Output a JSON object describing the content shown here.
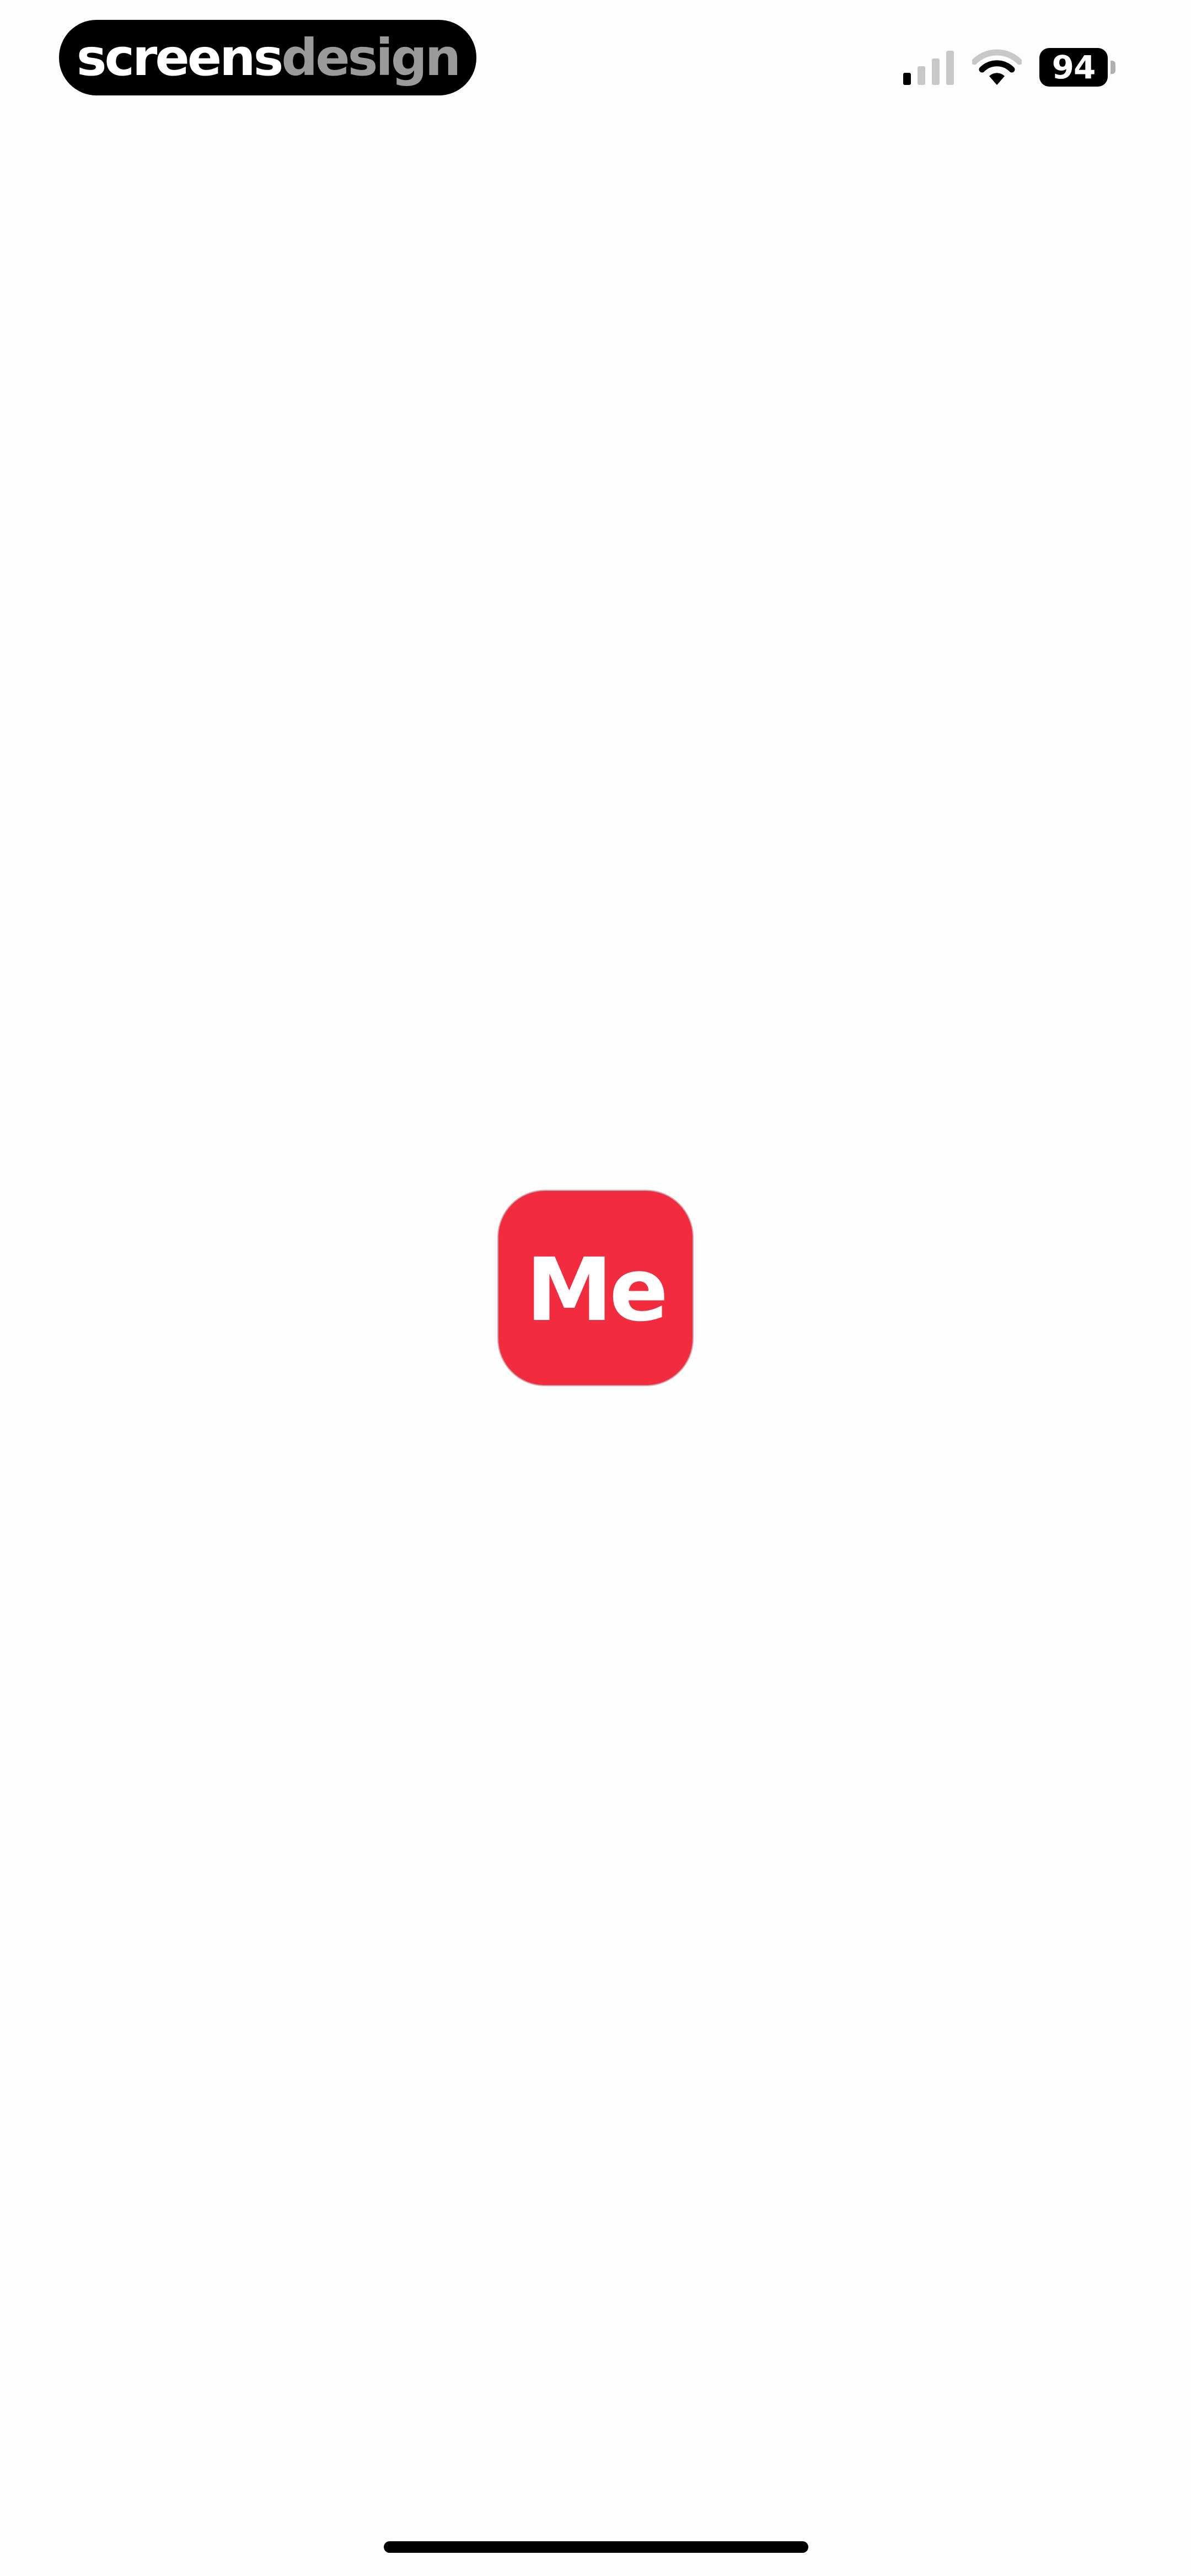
{
  "status_bar": {
    "brand_part1": "screens",
    "brand_part2": "design",
    "battery_level": "94",
    "signal_icon": "cellular-signal-icon",
    "wifi_icon": "wifi-icon"
  },
  "splash": {
    "logo_text": "Me",
    "logo_color": "#f32b3e"
  }
}
